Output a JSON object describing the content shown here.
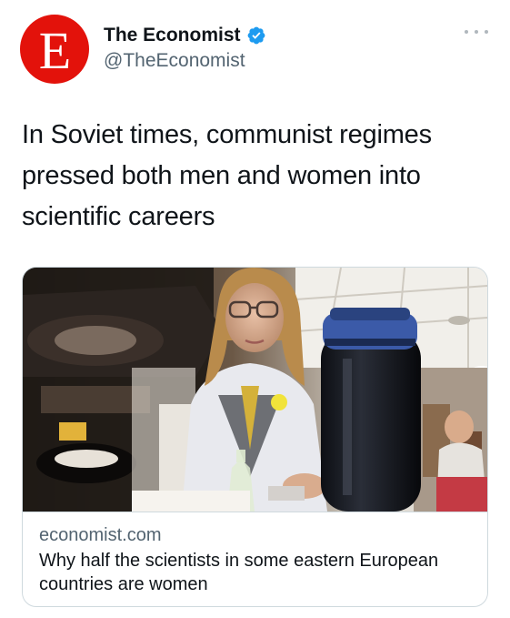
{
  "author": {
    "avatar_letter": "E",
    "display_name": "The Economist",
    "handle": "@TheEconomist",
    "verified": true,
    "icons": {
      "verified": "verified-badge-icon",
      "more": "more-options-icon"
    }
  },
  "tweet": {
    "text": "In Soviet times, communist regimes pressed both men and women into scientific careers"
  },
  "card": {
    "domain": "economist.com",
    "title": "Why half the scientists in some eastern European countries are women"
  },
  "colors": {
    "brand_red": "#e3120b",
    "verified_blue": "#1d9bf0",
    "secondary_text": "#536471",
    "border": "#cfd9de"
  }
}
